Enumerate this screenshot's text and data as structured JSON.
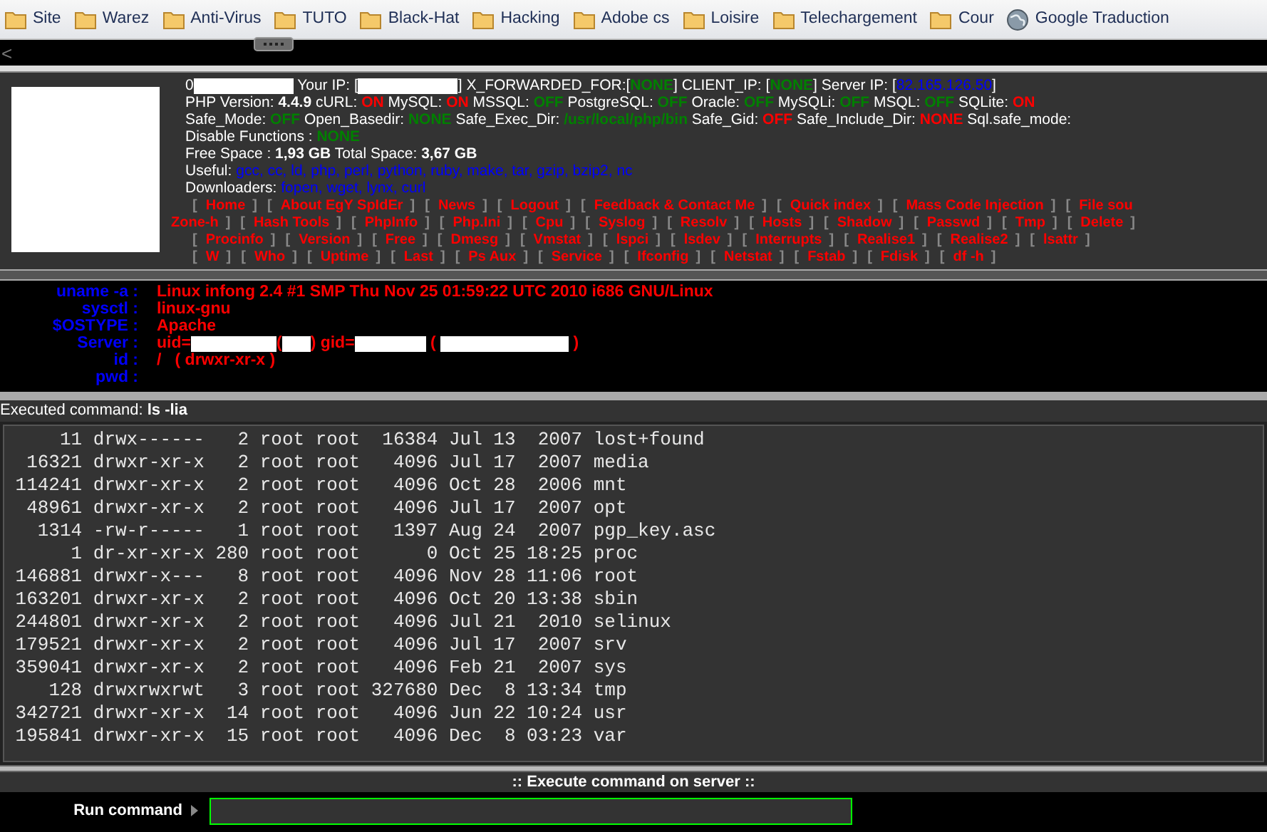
{
  "bookmarks": [
    {
      "label": "Site",
      "kind": "folder"
    },
    {
      "label": "Warez",
      "kind": "folder"
    },
    {
      "label": "Anti-Virus",
      "kind": "folder"
    },
    {
      "label": "TUTO",
      "kind": "folder"
    },
    {
      "label": "Black-Hat",
      "kind": "folder"
    },
    {
      "label": "Hacking",
      "kind": "folder"
    },
    {
      "label": "Adobe cs",
      "kind": "folder"
    },
    {
      "label": "Loisire",
      "kind": "folder"
    },
    {
      "label": "Telechargement",
      "kind": "folder"
    },
    {
      "label": "Cour",
      "kind": "folder"
    },
    {
      "label": "Google Traduction",
      "kind": "web"
    }
  ],
  "scroll_left": "<",
  "info_lines": [
    [
      {
        "text": "0",
        "kind": "text"
      },
      {
        "kind": "redacted"
      },
      {
        "text": " Your IP: [",
        "kind": "text"
      },
      {
        "kind": "redacted"
      },
      {
        "text": "] X_FORWARDED_FOR:[",
        "kind": "text"
      },
      {
        "text": "NONE",
        "kind": "green"
      },
      {
        "text": "] CLIENT_IP: [",
        "kind": "text"
      },
      {
        "text": "NONE",
        "kind": "green"
      },
      {
        "text": "] Server IP: [",
        "kind": "text"
      },
      {
        "text": "82.165.126.50",
        "kind": "blue"
      },
      {
        "text": "]",
        "kind": "text"
      }
    ],
    [
      {
        "text": "PHP Version: ",
        "kind": "text"
      },
      {
        "text": "4.4.9",
        "kind": "bold"
      },
      {
        "text": " cURL: ",
        "kind": "text"
      },
      {
        "text": "ON",
        "kind": "red"
      },
      {
        "text": " MySQL: ",
        "kind": "text"
      },
      {
        "text": "ON",
        "kind": "red"
      },
      {
        "text": " MSSQL: ",
        "kind": "text"
      },
      {
        "text": "OFF",
        "kind": "green"
      },
      {
        "text": " PostgreSQL: ",
        "kind": "text"
      },
      {
        "text": "OFF",
        "kind": "green"
      },
      {
        "text": " Oracle: ",
        "kind": "text"
      },
      {
        "text": "OFF",
        "kind": "green"
      },
      {
        "text": " MySQLi: ",
        "kind": "text"
      },
      {
        "text": "OFF",
        "kind": "green"
      },
      {
        "text": " MSQL: ",
        "kind": "text"
      },
      {
        "text": "OFF",
        "kind": "green"
      },
      {
        "text": " SQLite: ",
        "kind": "text"
      },
      {
        "text": "ON",
        "kind": "red"
      }
    ],
    [
      {
        "text": "Safe_Mode: ",
        "kind": "text"
      },
      {
        "text": "OFF",
        "kind": "green"
      },
      {
        "text": " Open_Basedir: ",
        "kind": "text"
      },
      {
        "text": "NONE",
        "kind": "green"
      },
      {
        "text": " Safe_Exec_Dir: ",
        "kind": "text"
      },
      {
        "text": "/usr/local/php/bin",
        "kind": "green"
      },
      {
        "text": " Safe_Gid: ",
        "kind": "text"
      },
      {
        "text": "OFF",
        "kind": "red"
      },
      {
        "text": " Safe_Include_Dir: ",
        "kind": "text"
      },
      {
        "text": "NONE",
        "kind": "red"
      },
      {
        "text": " Sql.safe_mode:",
        "kind": "text"
      }
    ],
    [
      {
        "text": "Disable Functions : ",
        "kind": "text"
      },
      {
        "text": "NONE",
        "kind": "green"
      }
    ],
    [
      {
        "text": "Free Space : ",
        "kind": "text"
      },
      {
        "text": "1,93 GB",
        "kind": "bold"
      },
      {
        "text": " Total Space: ",
        "kind": "text"
      },
      {
        "text": "3,67 GB",
        "kind": "bold"
      }
    ],
    [
      {
        "text": "Useful: ",
        "kind": "text"
      },
      {
        "text": "gcc, cc, ld, php, perl, python, ruby, make, tar, gzip, bzip2, nc",
        "kind": "blue"
      }
    ],
    [
      {
        "text": "Downloaders: ",
        "kind": "text"
      },
      {
        "text": "fopen, wget, lynx, curl",
        "kind": "blue"
      }
    ]
  ],
  "nav_rows": [
    [
      {
        "open": "[",
        "label": "Home",
        "close": "]"
      },
      {
        "open": "[",
        "label": "About EgY SpIdEr",
        "close": "]"
      },
      {
        "open": "[",
        "label": "News",
        "close": "]"
      },
      {
        "open": "[",
        "label": "Logout",
        "close": "]"
      },
      {
        "open": "[",
        "label": "Feedback & Contact Me",
        "close": "]"
      },
      {
        "open": "[",
        "label": "Quick index",
        "close": "]"
      },
      {
        "open": "[",
        "label": "Mass Code Injection",
        "close": "]"
      },
      {
        "open": "[",
        "label": "File sou"
      }
    ],
    [
      {
        "label": "Zone-h",
        "close": "]"
      },
      {
        "open": "[",
        "label": "Hash Tools",
        "close": "]"
      },
      {
        "open": "[",
        "label": "PhpInfo",
        "close": "]"
      },
      {
        "open": "[",
        "label": "Php.Ini",
        "close": "]"
      },
      {
        "open": "[",
        "label": "Cpu",
        "close": "]"
      },
      {
        "open": "[",
        "label": "Syslog",
        "close": "]"
      },
      {
        "open": "[",
        "label": "Resolv",
        "close": "]"
      },
      {
        "open": "[",
        "label": "Hosts",
        "close": "]"
      },
      {
        "open": "[",
        "label": "Shadow",
        "close": "]"
      },
      {
        "open": "[",
        "label": "Passwd",
        "close": "]"
      },
      {
        "open": "[",
        "label": "Tmp",
        "close": "]"
      },
      {
        "open": "[",
        "label": "Delete",
        "close": "]"
      }
    ],
    [
      {
        "open": "[",
        "label": "Procinfo",
        "close": "]"
      },
      {
        "open": "[",
        "label": "Version",
        "close": "]"
      },
      {
        "open": "[",
        "label": "Free",
        "close": "]"
      },
      {
        "open": "[",
        "label": "Dmesg",
        "close": "]"
      },
      {
        "open": "[",
        "label": "Vmstat",
        "close": "]"
      },
      {
        "open": "[",
        "label": "lspci",
        "close": "]"
      },
      {
        "open": "[",
        "label": "lsdev",
        "close": "]"
      },
      {
        "open": "[",
        "label": "Interrupts",
        "close": "]"
      },
      {
        "open": "[",
        "label": "Realise1",
        "close": "]"
      },
      {
        "open": "[",
        "label": "Realise2",
        "close": "]"
      },
      {
        "open": "[",
        "label": "lsattr",
        "close": "]"
      }
    ],
    [
      {
        "open": "[",
        "label": "W",
        "close": "]"
      },
      {
        "open": "[",
        "label": "Who",
        "close": "]"
      },
      {
        "open": "[",
        "label": "Uptime",
        "close": "]"
      },
      {
        "open": "[",
        "label": "Last",
        "close": "]"
      },
      {
        "open": "[",
        "label": "Ps Aux",
        "close": "]"
      },
      {
        "open": "[",
        "label": "Service",
        "close": "]"
      },
      {
        "open": "[",
        "label": "Ifconfig",
        "close": "]"
      },
      {
        "open": "[",
        "label": "Netstat",
        "close": "]"
      },
      {
        "open": "[",
        "label": "Fstab",
        "close": "]"
      },
      {
        "open": "[",
        "label": "Fdisk",
        "close": "]"
      },
      {
        "open": "[",
        "label": "df -h",
        "close": "]"
      }
    ]
  ],
  "system": [
    {
      "label": "uname -a :",
      "value": [
        {
          "text": "Linux infong 2.4 #1 SMP Thu Nov 25 01:59:22 UTC 2010 i686 GNU/Linux",
          "kind": "text"
        }
      ]
    },
    {
      "label": "sysctl :",
      "value": [
        {
          "text": "linux-gnu",
          "kind": "text"
        }
      ]
    },
    {
      "label": "$OSTYPE :",
      "value": [
        {
          "text": "Apache",
          "kind": "text"
        }
      ]
    },
    {
      "label": "Server :",
      "value": [
        {
          "text": "uid=",
          "kind": "text"
        },
        {
          "kind": "redacted"
        },
        {
          "text": "(",
          "kind": "text"
        },
        {
          "kind": "redacted"
        },
        {
          "text": ") gid=",
          "kind": "text"
        },
        {
          "kind": "redacted"
        },
        {
          "text": " ( ",
          "kind": "text"
        },
        {
          "kind": "redacted"
        },
        {
          "text": " )",
          "kind": "text"
        }
      ]
    },
    {
      "label": "id :",
      "value": [
        {
          "text": "/   ( drwxr-xr-x )",
          "kind": "text"
        }
      ]
    },
    {
      "label": "pwd :"
    }
  ],
  "executed": {
    "label": "Executed command: ",
    "command": "ls -lia"
  },
  "listing": [
    [
      "11",
      "drwx------",
      "2",
      "root",
      "root",
      "16384",
      "Jul",
      "13",
      "2007",
      "lost+found"
    ],
    [
      "16321",
      "drwxr-xr-x",
      "2",
      "root",
      "root",
      "4096",
      "Jul",
      "17",
      "2007",
      "media"
    ],
    [
      "114241",
      "drwxr-xr-x",
      "2",
      "root",
      "root",
      "4096",
      "Oct",
      "28",
      "2006",
      "mnt"
    ],
    [
      "48961",
      "drwxr-xr-x",
      "2",
      "root",
      "root",
      "4096",
      "Jul",
      "17",
      "2007",
      "opt"
    ],
    [
      "1314",
      "-rw-r-----",
      "1",
      "root",
      "root",
      "1397",
      "Aug",
      "24",
      "2007",
      "pgp_key.asc"
    ],
    [
      "1",
      "dr-xr-xr-x",
      "280",
      "root",
      "root",
      "0",
      "Oct",
      "25",
      "18:25",
      "proc"
    ],
    [
      "146881",
      "drwxr-x---",
      "8",
      "root",
      "root",
      "4096",
      "Nov",
      "28",
      "11:06",
      "root"
    ],
    [
      "163201",
      "drwxr-xr-x",
      "2",
      "root",
      "root",
      "4096",
      "Oct",
      "20",
      "13:38",
      "sbin"
    ],
    [
      "244801",
      "drwxr-xr-x",
      "2",
      "root",
      "root",
      "4096",
      "Jul",
      "21",
      "2010",
      "selinux"
    ],
    [
      "179521",
      "drwxr-xr-x",
      "2",
      "root",
      "root",
      "4096",
      "Jul",
      "17",
      "2007",
      "srv"
    ],
    [
      "359041",
      "drwxr-xr-x",
      "2",
      "root",
      "root",
      "4096",
      "Feb",
      "21",
      "2007",
      "sys"
    ],
    [
      "128",
      "drwxrwxrwt",
      "3",
      "root",
      "root",
      "327680",
      "Dec",
      "8",
      "13:34",
      "tmp"
    ],
    [
      "342721",
      "drwxr-xr-x",
      "14",
      "root",
      "root",
      "4096",
      "Jun",
      "22",
      "10:24",
      "usr"
    ],
    [
      "195841",
      "drwxr-xr-x",
      "15",
      "root",
      "root",
      "4096",
      "Dec",
      "8",
      "03:23",
      "var"
    ]
  ],
  "execute": {
    "title": ":: Execute command on server ::",
    "label": "Run command"
  }
}
